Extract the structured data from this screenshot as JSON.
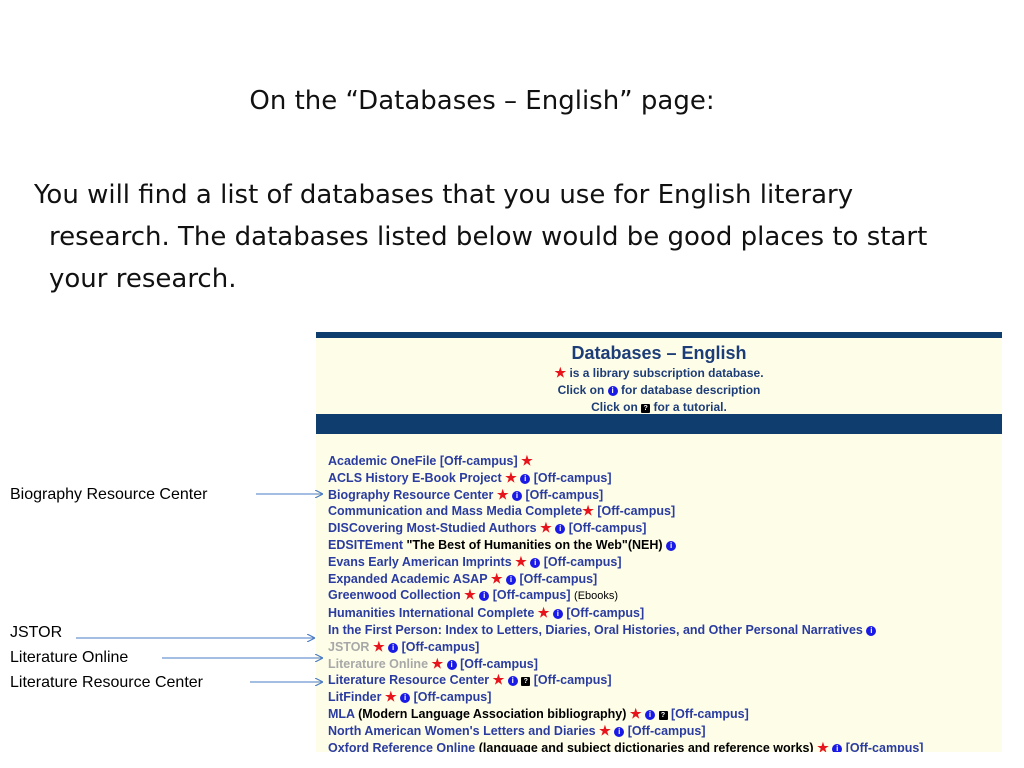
{
  "slide": {
    "title": "On the “Databases – English” page:",
    "body": "You will find a list of databases that you use for English literary research.  The databases listed below would be good places to start your research."
  },
  "screenshot": {
    "heading": "Databases – English",
    "legend": {
      "star_text": "is a library subscription database.",
      "info_prefix": "Click on",
      "info_suffix": "for database description",
      "tutorial_prefix": "Click on",
      "tutorial_suffix": "for a tutorial."
    },
    "databases": [
      {
        "name": "Academic OneFile [Off-campus]",
        "mark": "star"
      },
      {
        "name": "ACLS History E-Book Project",
        "tail": "[Off-campus]"
      },
      {
        "name": "Biography Resource Center",
        "tail": "[Off-campus]"
      },
      {
        "name": "Communication and Mass Media Complete",
        "tail": "[Off-campus]"
      },
      {
        "name": "DISCovering Most-Studied Authors",
        "tail": "[Off-campus]"
      },
      {
        "name": "EDSITEment",
        "extra": "\"The Best of Humanities on the Web\"(NEH)"
      },
      {
        "name": "Evans Early American Imprints",
        "tail": "[Off-campus]"
      },
      {
        "name": "Expanded Academic ASAP",
        "tail": "[Off-campus]"
      },
      {
        "name": "Greenwood Collection",
        "tail": "[Off-campus]",
        "note": "(Ebooks)"
      },
      {
        "name": "Humanities International Complete",
        "tail": "[Off-campus]"
      },
      {
        "name": "In the First Person: Index to Letters, Diaries, Oral Histories, and Other Personal Narratives"
      },
      {
        "name": "JSTOR",
        "tail": "[Off-campus]"
      },
      {
        "name": "Literature Online",
        "tail": "[Off-campus]"
      },
      {
        "name": "Literature Resource Center",
        "tail": "[Off-campus]"
      },
      {
        "name": "LitFinder",
        "tail": "[Off-campus]"
      },
      {
        "name": "MLA",
        "extra": "(Modern Language Association bibliography)",
        "tail": "[Off-campus]"
      },
      {
        "name": "North American Women's Letters and Diaries",
        "tail": "[Off-campus]"
      },
      {
        "name": "Oxford Reference Online",
        "extra": "(language and subject dictionaries and reference works)",
        "tail": "[Off-campus]"
      }
    ]
  },
  "callouts": {
    "biography": "Biography Resource Center",
    "jstor": "JSTOR",
    "lit_online": "Literature Online",
    "lit_resource": "Literature Resource Center"
  },
  "icons": {
    "star": "★",
    "info": "i",
    "tutorial": "?"
  },
  "colors": {
    "bar": "#0f3d6e",
    "link": "#2a3ca0",
    "star": "#e8141c",
    "info": "#1a1ae6"
  }
}
